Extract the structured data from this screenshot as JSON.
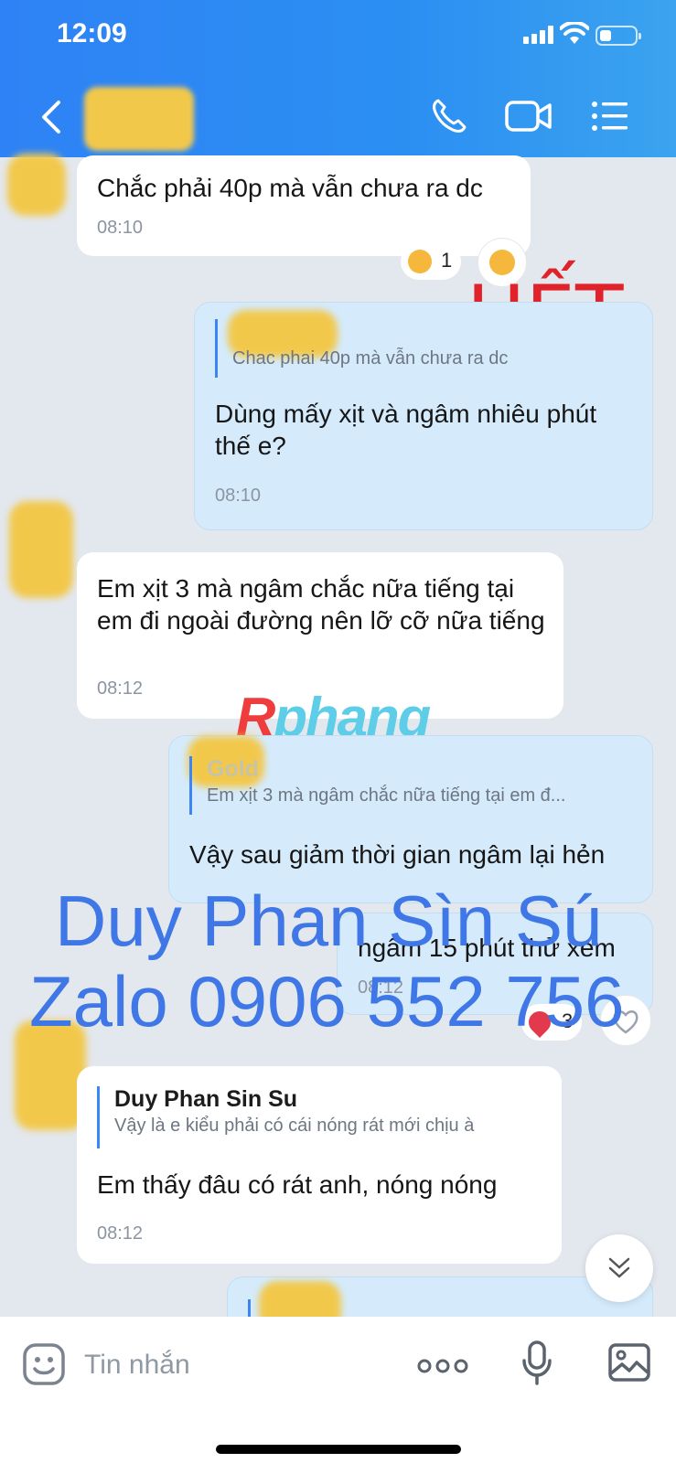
{
  "status": {
    "time": "12:09"
  },
  "header": {
    "back_icon": "chevron-left-icon",
    "call_icon": "phone-icon",
    "video_icon": "video-icon",
    "menu_icon": "list-menu-icon",
    "color": "#2f82f5"
  },
  "messages": [
    {
      "side": "in",
      "text": "Chắc phải 40p mà vẫn chưa ra dc",
      "time": "08:10",
      "reaction": {
        "emoji": "laughing-emoji",
        "count": "1"
      }
    },
    {
      "side": "out",
      "quote_text": "Chac phai 40p mà vẫn chưa ra dc",
      "text": "Dùng mấy xịt và ngâm nhiêu phút thế e?",
      "time": "08:10"
    },
    {
      "side": "in",
      "text": "Em xịt 3 mà ngâm chắc nữa tiếng tại em đi ngoài đường nên lỡ cỡ nữa tiếng",
      "time": "08:12"
    },
    {
      "side": "out",
      "quote_name": "Gold",
      "quote_text": "Em xịt 3 mà ngâm chắc nữa tiếng tại em đ...",
      "text": "Vậy sau giảm thời gian ngâm lại hẻn"
    },
    {
      "side": "out",
      "text": "ngâm 15 phút thử xem",
      "time": "08:12",
      "reaction": {
        "emoji": "heart-emoji",
        "count": "3"
      }
    },
    {
      "side": "in",
      "quote_name": "Duy Phan Sin Su",
      "quote_text": "Vậy là e kiểu phải có cái nóng rát mới chịu à",
      "text": "Em thấy đâu có rát anh, nóng nóng",
      "time": "08:12"
    }
  ],
  "watermarks": {
    "het": "HẾT",
    "brand_r": "R",
    "brand_rest": "phang",
    "line1": "Duy Phan Sìn Sú",
    "line2": "Zalo 0906 552 756"
  },
  "composer": {
    "placeholder": "Tin nhắn",
    "sticker_icon": "sticker-face-icon",
    "more_icon": "more-dots-icon",
    "mic_icon": "microphone-icon",
    "image_icon": "image-icon"
  },
  "scroll_down_icon": "double-chevron-down-icon"
}
